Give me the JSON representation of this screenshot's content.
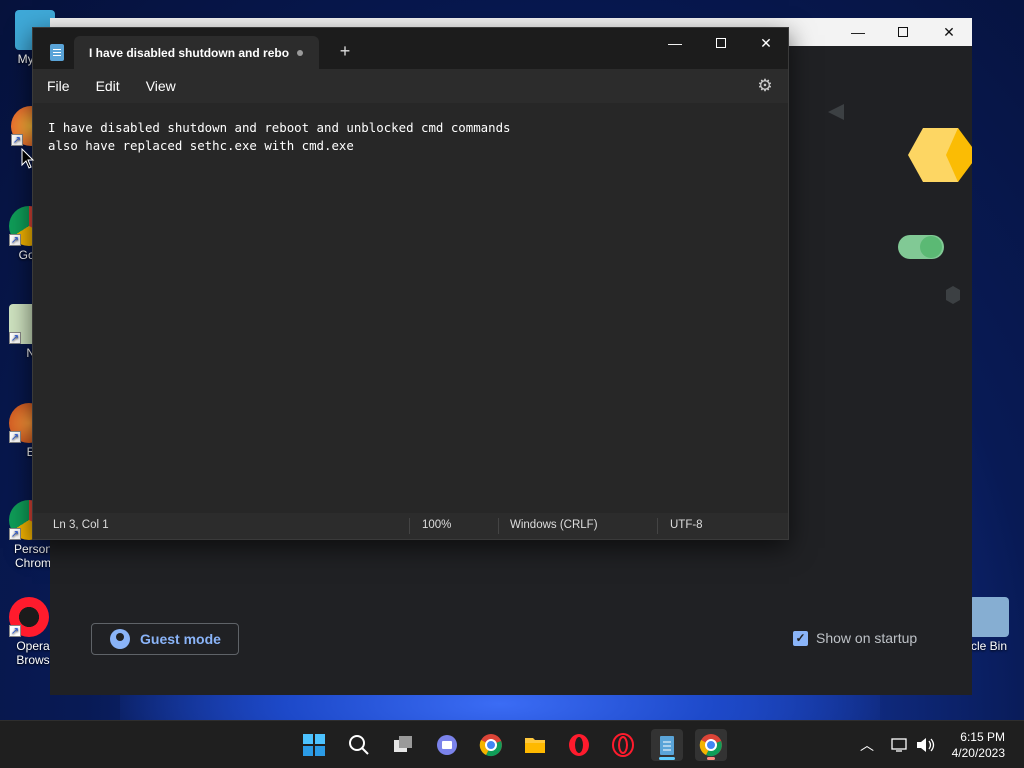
{
  "desktop": {
    "icons": [
      {
        "label": "My Co",
        "id": "my-computer"
      },
      {
        "label": "",
        "id": "firefox"
      },
      {
        "label": "Go Ch",
        "id": "google-chrome"
      },
      {
        "label": "Note",
        "id": "notepad-plus"
      },
      {
        "label": "Ever",
        "id": "everything"
      },
      {
        "label": "Person Chrom",
        "id": "personal-chrome"
      },
      {
        "label": "Opera Brows",
        "id": "opera-browser"
      },
      {
        "label": "cle Bin",
        "id": "recycle-bin"
      }
    ]
  },
  "chrome_window": {
    "guest_mode_label": "Guest mode",
    "show_on_startup_label": "Show on startup",
    "show_on_startup_checked": true
  },
  "notepad": {
    "tab_title": "I have disabled shutdown and rebo",
    "menu": {
      "file": "File",
      "edit": "Edit",
      "view": "View"
    },
    "content": "I have disabled shutdown and reboot and unblocked cmd commands\nalso have replaced sethc.exe with cmd.exe",
    "status": {
      "position": "Ln 3, Col 1",
      "zoom": "100%",
      "line_ending": "Windows (CRLF)",
      "encoding": "UTF-8"
    }
  },
  "taskbar": {
    "time": "6:15 PM",
    "date": "4/20/2023",
    "accent_color": "#60cdff"
  }
}
